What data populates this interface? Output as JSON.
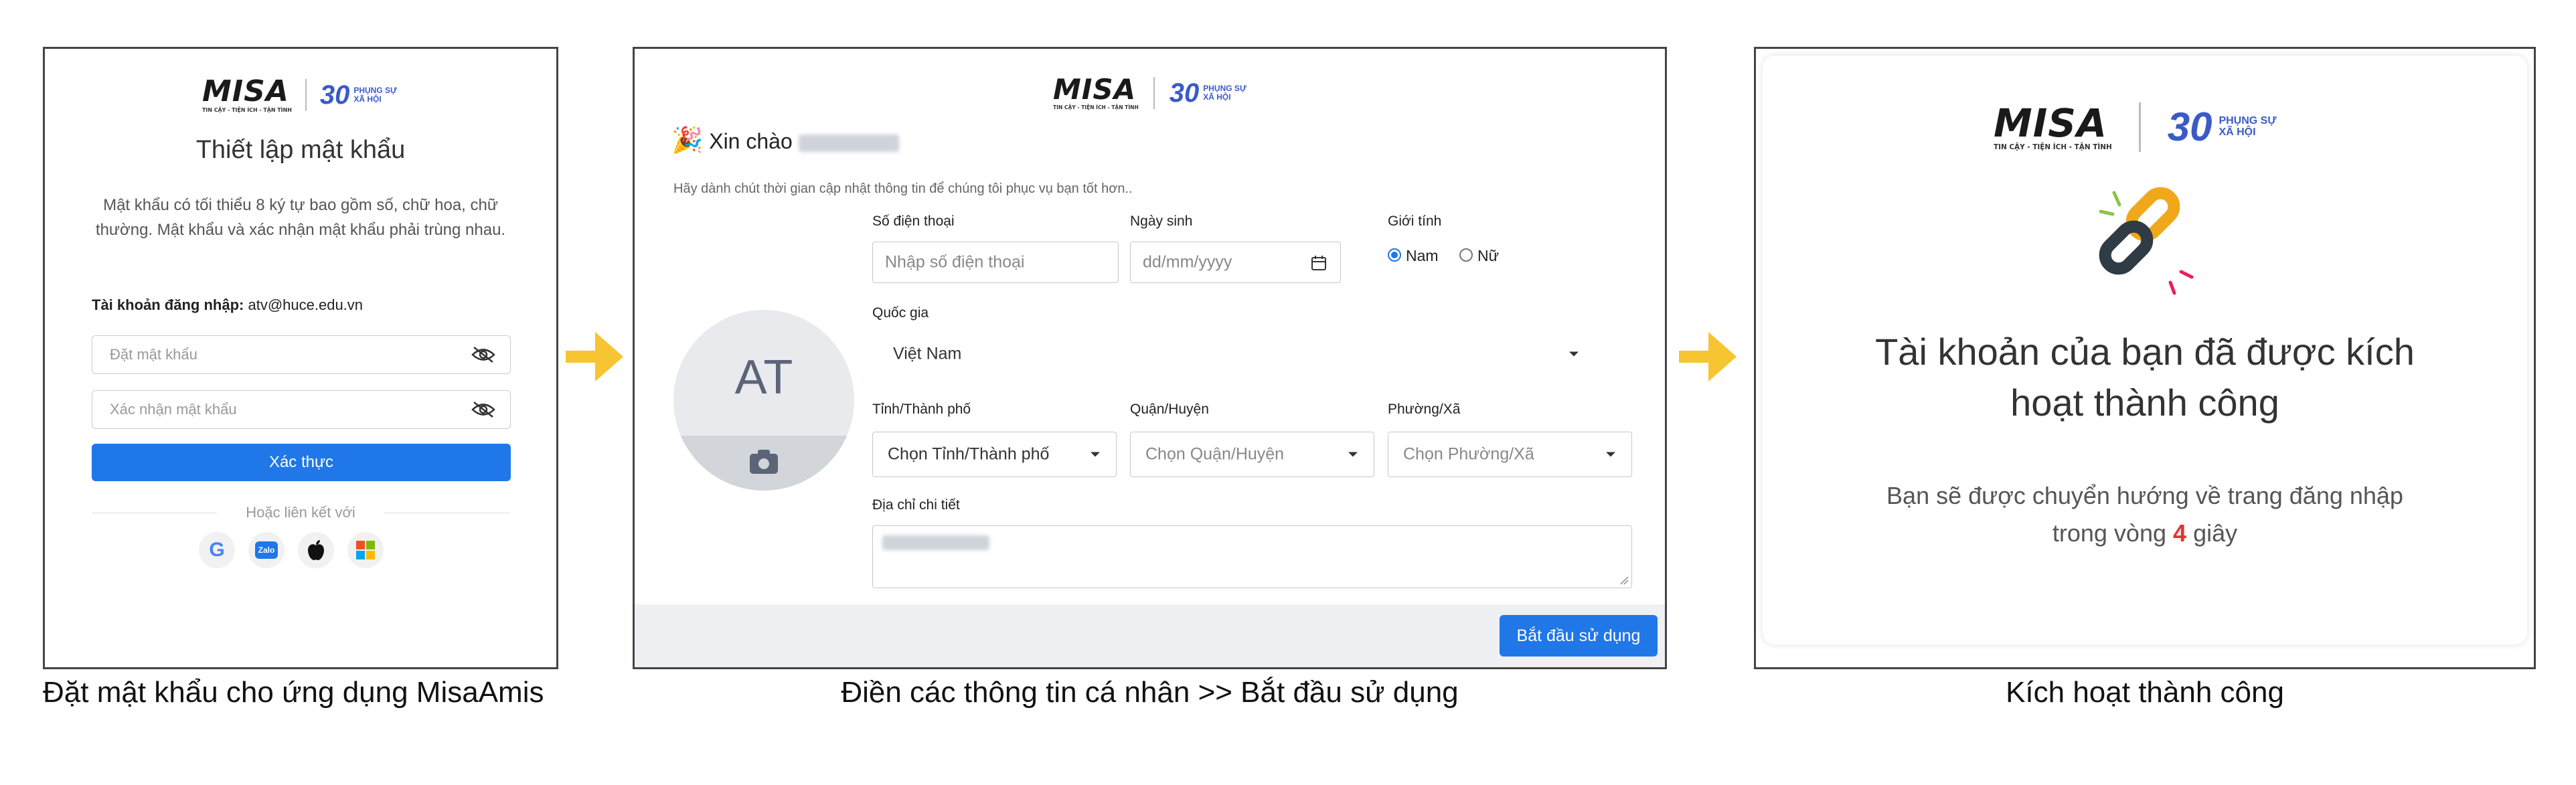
{
  "logo": {
    "brand": "MISA",
    "tagline": "TIN CẬY - TIỆN ÍCH - TẬN TÌNH",
    "anniversary": "30",
    "slogan_line1": "PHỤNG SỰ",
    "slogan_line2": "XÃ HỘI"
  },
  "panel1": {
    "title": "Thiết lập mật khẩu",
    "description": "Mật khẩu có tối thiểu 8 ký tự bao gồm số, chữ hoa, chữ thường. Mật khẩu và xác nhận mật khẩu phải trùng nhau.",
    "account_label": "Tài khoản đăng nhập:",
    "account_value": "atv@huce.edu.vn",
    "password_placeholder": "Đặt mật khẩu",
    "confirm_placeholder": "Xác nhận mật khẩu",
    "submit_label": "Xác thực",
    "link_label": "Hoặc liên kết với",
    "social_icons": [
      "google-icon",
      "zalo-icon",
      "apple-icon",
      "microsoft-icon"
    ],
    "social_zalo_text": "Zalo",
    "caption": "Đặt mật khẩu cho ứng dụng MisaAmis"
  },
  "panel2": {
    "greeting": "Xin chào",
    "subtitle": "Hãy dành chút thời gian cập nhật thông tin để chúng tôi phục vụ bạn tốt hơn..",
    "avatar_initials": "AT",
    "phone_label": "Số điện thoại",
    "phone_placeholder": "Nhập số điện thoại",
    "dob_label": "Ngày sinh",
    "dob_placeholder": "dd/mm/yyyy",
    "gender_label": "Giới tính",
    "gender_male": "Nam",
    "gender_female": "Nữ",
    "country_label": "Quốc gia",
    "country_value": "Việt Nam",
    "province_label": "Tỉnh/Thành phố",
    "province_placeholder": "Chọn Tỉnh/Thành phố",
    "district_label": "Quận/Huyện",
    "district_placeholder": "Chọn Quận/Huyện",
    "ward_label": "Phường/Xã",
    "ward_placeholder": "Chọn Phường/Xã",
    "address_label": "Địa chỉ chi tiết",
    "start_button": "Bắt đầu sử dụng",
    "caption": "Điền các thông tin cá nhân >> Bắt đầu sử dụng"
  },
  "panel3": {
    "title": "Tài khoản của bạn đã được kích hoạt thành công",
    "text_before": "Bạn sẽ được chuyển hướng về trang đăng nhập trong vòng",
    "countdown": "4",
    "text_after": "giây",
    "caption": "Kích hoạt thành công"
  },
  "colors": {
    "primary": "#1f77e8",
    "arrow": "#f7c531",
    "accent_red": "#e2352d"
  }
}
